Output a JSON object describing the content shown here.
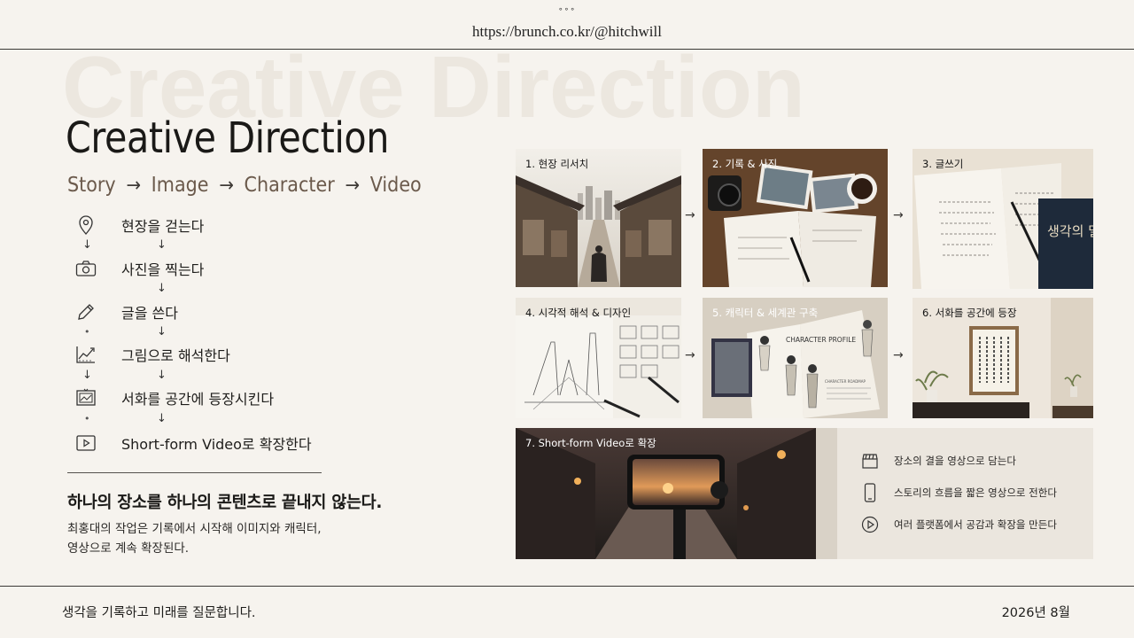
{
  "header": {
    "dots": "∘∘∘",
    "url": "https://brunch.co.kr/@hitchwill"
  },
  "hero": {
    "watermark": "Creative Direction",
    "title": "Creative Direction",
    "flow": [
      "Story",
      "Image",
      "Character",
      "Video"
    ],
    "flow_arrow": "→"
  },
  "steps": [
    {
      "label": "현장을 걷는다",
      "icon": "map-pin-icon"
    },
    {
      "label": "사진을 찍는다",
      "icon": "camera-icon"
    },
    {
      "label": "글을 쓴다",
      "icon": "pencil-icon"
    },
    {
      "label": "그림으로 해석한다",
      "icon": "chart-sketch-icon"
    },
    {
      "label": "서화를 공간에 등장시킨다",
      "icon": "framed-picture-icon"
    },
    {
      "label": "Short-form Video로 확장한다",
      "icon": "play-button-icon"
    }
  ],
  "step_arrow": "↓",
  "step_dot": "•",
  "tagline": "하나의 장소를 하나의 콘텐츠로 끝내지 않는다.",
  "description": [
    "최홍대의 작업은 기록에서 시작해 이미지와 캐릭터,",
    "영상으로 계속 확장된다."
  ],
  "grid_arrow": "→",
  "panels": [
    {
      "caption": "1. 현장 리서치"
    },
    {
      "caption": "2. 기록 & 사진"
    },
    {
      "caption": "3. 글쓰기"
    },
    {
      "caption": "4. 시각적 해석 & 디자인"
    },
    {
      "caption": "5. 캐릭터 & 세계관 구축"
    },
    {
      "caption": "6. 서화를 공간에 등장"
    },
    {
      "caption": "7. Short-form Video로 확장"
    }
  ],
  "panel_texts": {
    "book_title": "생각의 밀도",
    "profile_title": "CHARACTER PROFILE",
    "profile_sub": "CHARACTER ROADMAP"
  },
  "video_features": [
    {
      "label": "장소의 결을 영상으로 담는다",
      "icon": "clapperboard-icon"
    },
    {
      "label": "스토리의 흐름을 짧은 영상으로 전한다",
      "icon": "smartphone-icon"
    },
    {
      "label": "여러 플랫폼에서 공감과 확장을 만든다",
      "icon": "play-circle-icon"
    }
  ],
  "footer": {
    "left": "생각을 기록하고 미래를 질문합니다.",
    "right": "2026년 8월"
  }
}
